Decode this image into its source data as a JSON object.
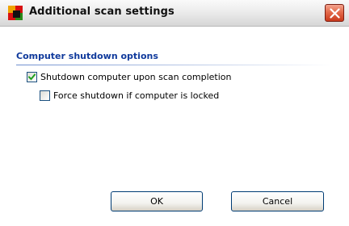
{
  "window": {
    "title": "Additional scan settings",
    "app_icon": "avg-app-icon",
    "close_icon": "close-icon"
  },
  "group": {
    "title": "Computer shutdown options"
  },
  "options": [
    {
      "label": "Shutdown computer upon scan completion",
      "checked": true,
      "enabled": true
    },
    {
      "label": "Force shutdown if computer is locked",
      "checked": false,
      "enabled": true
    }
  ],
  "buttons": {
    "ok_label": "OK",
    "cancel_label": "Cancel"
  },
  "colors": {
    "group_title": "#103a9c",
    "close_button": "#d9502d",
    "checkmark": "#21a121"
  }
}
